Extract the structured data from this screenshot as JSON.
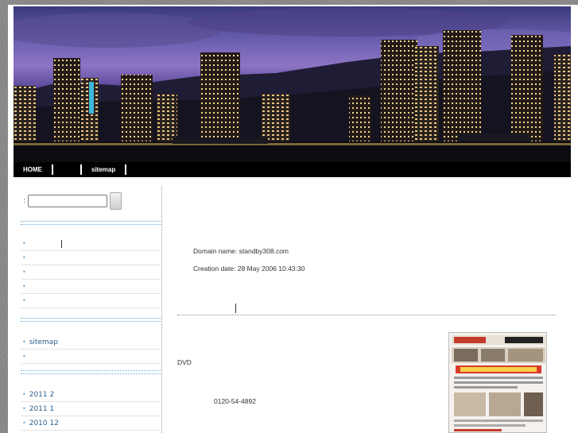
{
  "nav": {
    "items": [
      "HOME",
      "",
      "sitemap"
    ]
  },
  "sidebar": {
    "search": {
      "label": ":",
      "value": ""
    },
    "group1": [
      "",
      "",
      "",
      "",
      ""
    ],
    "group2": [
      "sitemap",
      ""
    ],
    "archives": [
      "2011 2",
      "2011 1",
      "2010 12"
    ]
  },
  "main": {
    "domain_line": "Domain name: standby308.com",
    "creation_line": "Creation date: 28 May 2006 10:43:30",
    "dvd_label": "DVD",
    "phone": "0120-54-4892"
  },
  "colors": {
    "link": "#2a5d8a",
    "divider": "#6aa9d6",
    "nav_bg": "#000000"
  }
}
